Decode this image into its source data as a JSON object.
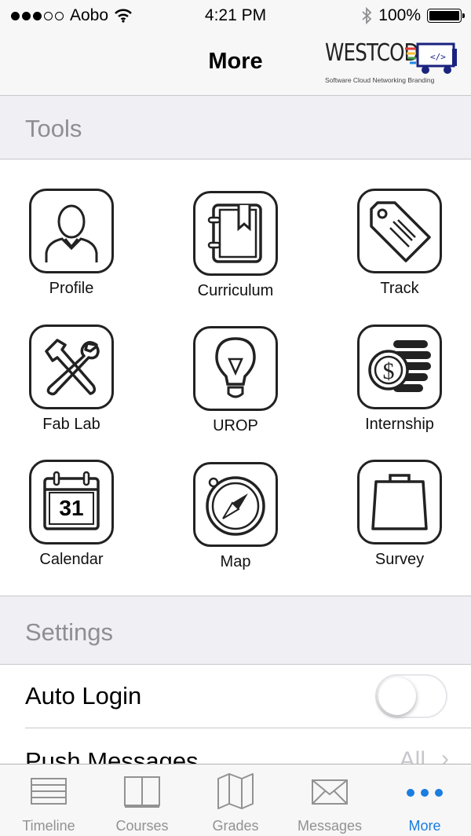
{
  "status_bar": {
    "carrier": "Aobo",
    "time": "4:21 PM",
    "battery": "100%"
  },
  "nav": {
    "title": "More",
    "logo_word": "WESTCODE",
    "logo_tagline": "Software  Cloud  Networking  Branding"
  },
  "tools": {
    "header": "Tools",
    "items": [
      {
        "label": "Profile",
        "icon": "profile-icon"
      },
      {
        "label": "Curriculum",
        "icon": "notebook-icon"
      },
      {
        "label": "Track",
        "icon": "tag-icon"
      },
      {
        "label": "Fab Lab",
        "icon": "tools-icon"
      },
      {
        "label": "UROP",
        "icon": "lightbulb-icon"
      },
      {
        "label": "Internship",
        "icon": "coins-icon"
      },
      {
        "label": "Calendar",
        "icon": "calendar-icon",
        "day": "31"
      },
      {
        "label": "Map",
        "icon": "compass-icon"
      },
      {
        "label": "Survey",
        "icon": "bag-icon"
      }
    ]
  },
  "settings": {
    "header": "Settings",
    "rows": [
      {
        "label": "Auto Login",
        "toggle": false
      },
      {
        "label": "Push Messages",
        "value": "All"
      }
    ]
  },
  "tab_bar": {
    "active_color": "#1a7de0",
    "tabs": [
      {
        "label": "Timeline",
        "icon": "timeline-icon"
      },
      {
        "label": "Courses",
        "icon": "book-icon"
      },
      {
        "label": "Grades",
        "icon": "map-icon"
      },
      {
        "label": "Messages",
        "icon": "envelope-icon"
      },
      {
        "label": "More",
        "icon": "more-dots-icon",
        "active": true
      }
    ]
  }
}
